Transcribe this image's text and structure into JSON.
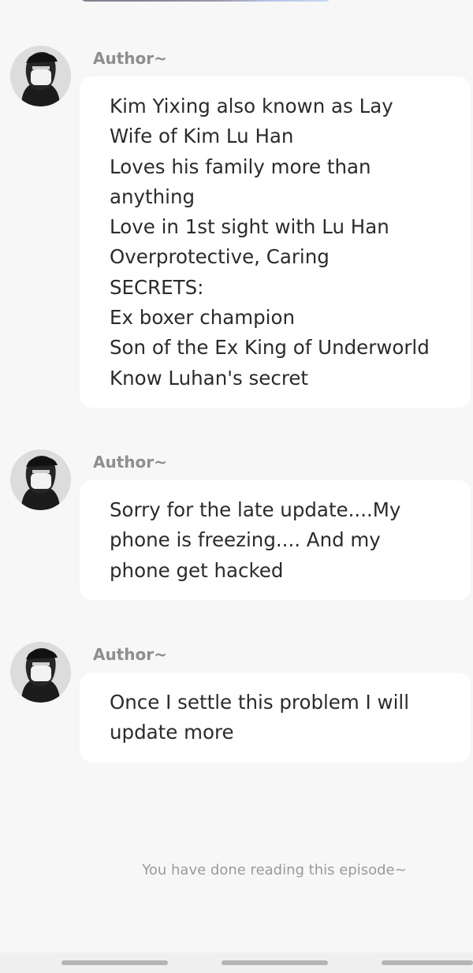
{
  "messages": [
    {
      "author": "Author~",
      "lines": [
        "Kim Yixing also known as Lay",
        "Wife of Kim Lu Han",
        "Loves his family more than",
        "anything",
        "Love in 1st sight with Lu Han",
        "Overprotective, Caring",
        "SECRETS:",
        "Ex boxer champion",
        "Son of the Ex King of Underworld",
        "Know Luhan's secret"
      ]
    },
    {
      "author": "Author~",
      "lines": [
        "Sorry for the late update....My",
        "phone is freezing.... And my",
        "phone get hacked"
      ]
    },
    {
      "author": "Author~",
      "lines": [
        "Once I settle this problem I will",
        "update more"
      ]
    }
  ],
  "footer": {
    "end_text": "You have done reading this episode~"
  }
}
